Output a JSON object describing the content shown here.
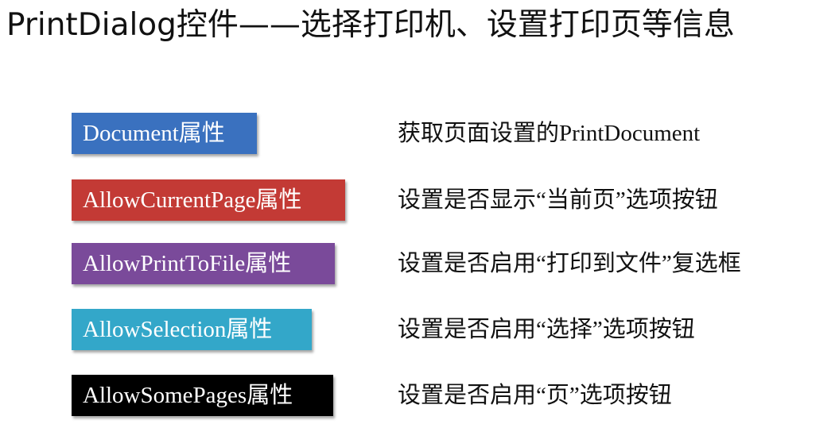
{
  "title": "PrintDialog控件——选择打印机、设置打印页等信息",
  "properties": [
    {
      "label": "Document属性",
      "description": "获取页面设置的PrintDocument",
      "color": "#3a71bf"
    },
    {
      "label": "AllowCurrentPage属性",
      "description": "设置是否显示“当前页”选项按钮",
      "color": "#c33a35"
    },
    {
      "label": "AllowPrintToFile属性",
      "description": "设置是否启用“打印到文件”复选框",
      "color": "#7a4a9a"
    },
    {
      "label": "AllowSelection属性",
      "description": "设置是否启用“选择”选项按钮",
      "color": "#33a7c9"
    },
    {
      "label": "AllowSomePages属性",
      "description": "设置是否启用“页”选项按钮",
      "color": "#000000"
    }
  ]
}
